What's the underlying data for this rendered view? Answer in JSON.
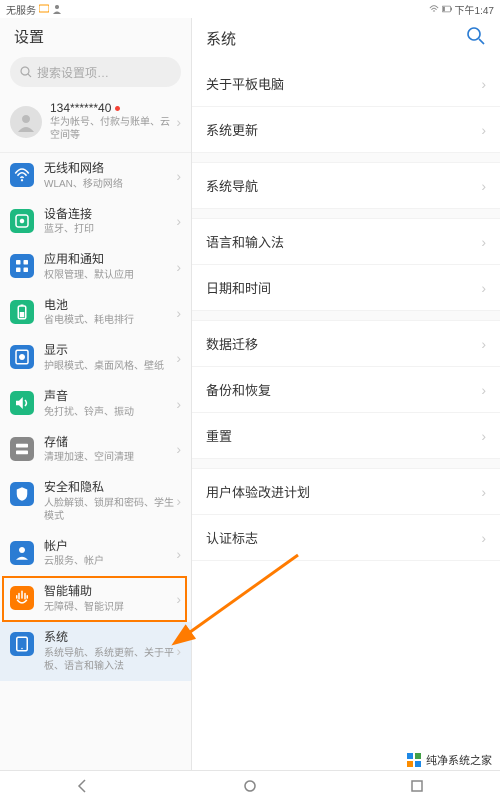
{
  "status": {
    "noService": "无服务",
    "time": "下午1:47"
  },
  "left": {
    "title": "设置",
    "searchPlaceholder": "搜索设置项…",
    "account": {
      "phone": "134******40",
      "sub": "华为帐号、付款与账单、云空间等"
    },
    "items": [
      {
        "title": "无线和网络",
        "sub": "WLAN、移动网络",
        "icon": "wifi",
        "color": "#2b7cd3"
      },
      {
        "title": "设备连接",
        "sub": "蓝牙、打印",
        "icon": "device",
        "color": "#1eb980"
      },
      {
        "title": "应用和通知",
        "sub": "权限管理、默认应用",
        "icon": "apps",
        "color": "#2b7cd3"
      },
      {
        "title": "电池",
        "sub": "省电模式、耗电排行",
        "icon": "battery",
        "color": "#1eb980"
      },
      {
        "title": "显示",
        "sub": "护眼模式、桌面风格、壁纸",
        "icon": "display",
        "color": "#2b7cd3"
      },
      {
        "title": "声音",
        "sub": "免打扰、铃声、振动",
        "icon": "sound",
        "color": "#1eb980"
      },
      {
        "title": "存储",
        "sub": "清理加速、空间清理",
        "icon": "storage",
        "color": "#888"
      },
      {
        "title": "安全和隐私",
        "sub": "人脸解锁、锁屏和密码、学生模式",
        "icon": "security",
        "color": "#2b7cd3"
      },
      {
        "title": "帐户",
        "sub": "云服务、帐户",
        "icon": "account",
        "color": "#2b7cd3"
      },
      {
        "title": "智能辅助",
        "sub": "无障碍、智能识屏",
        "icon": "assist",
        "color": "#ff7b00"
      },
      {
        "title": "系统",
        "sub": "系统导航、系统更新、关于平板、语言和输入法",
        "icon": "system",
        "color": "#2b7cd3"
      }
    ]
  },
  "right": {
    "title": "系统",
    "items": [
      {
        "label": "关于平板电脑"
      },
      {
        "label": "系统更新"
      },
      {
        "spacer": true
      },
      {
        "label": "系统导航"
      },
      {
        "spacer": true
      },
      {
        "label": "语言和输入法"
      },
      {
        "label": "日期和时间"
      },
      {
        "spacer": true
      },
      {
        "label": "数据迁移"
      },
      {
        "label": "备份和恢复"
      },
      {
        "label": "重置"
      },
      {
        "spacer": true
      },
      {
        "label": "用户体验改进计划"
      },
      {
        "label": "认证标志"
      }
    ]
  },
  "watermark": {
    "text": "纯净系统之家",
    "url": "www.ycwjzy.com"
  }
}
